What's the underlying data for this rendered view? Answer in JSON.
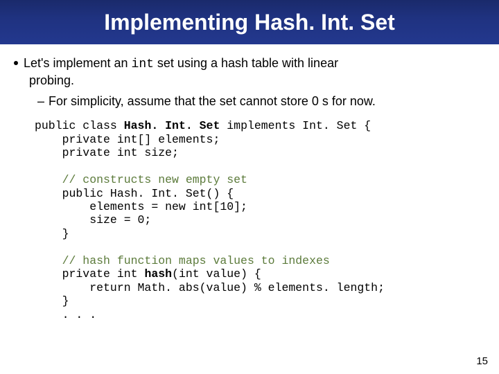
{
  "title": "Implementing Hash. Int. Set",
  "bullet": {
    "line1_pre": "Let's implement an ",
    "line1_code": "int",
    "line1_post": " set using a hash table with linear",
    "line2": "probing."
  },
  "sub": "For simplicity, assume that the set cannot store 0 s for now.",
  "code": {
    "l1_a": "public class ",
    "l1_b": "Hash. Int. Set",
    "l1_c": " implements Int. Set {",
    "l2": "    private int[] elements;",
    "l3": "    private int size;",
    "blank1": "",
    "l4_cmt": "    // constructs new empty set",
    "l5": "    public Hash. Int. Set() {",
    "l6": "        elements = new int[10];",
    "l7": "        size = 0;",
    "l8": "    }",
    "blank2": "",
    "l9_cmt": "    // hash function maps values to indexes",
    "l10_a": "    private int ",
    "l10_b": "hash",
    "l10_c": "(int value) {",
    "l11": "        return Math. abs(value) % elements. length;",
    "l12": "    }",
    "l13": "    . . ."
  },
  "page_number": "15"
}
